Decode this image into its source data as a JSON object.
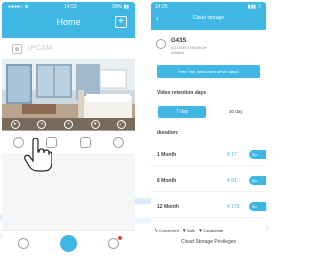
{
  "left_screen": {
    "status_bar": {
      "carrier": "●●●●○ ⊕",
      "time": "14:53",
      "battery": "99% ▮▮"
    },
    "title": "Home",
    "add_icon": "plus-square-icon",
    "device": {
      "name": "IPCAM",
      "icon": "camera-icon"
    },
    "video_controls": [
      "play-icon",
      "speaker-icon",
      "hd-icon",
      "record-icon",
      "fullscreen-icon"
    ],
    "actions": [
      "cloud-icon",
      "sd-card-icon",
      "calendar-icon",
      "settings-icon"
    ],
    "tab_bar": [
      "message-icon",
      "home-icon",
      "user-icon"
    ]
  },
  "right_screen": {
    "status_bar": {
      "time": "14:25",
      "signal": "▮▮▮ ⌔"
    },
    "back": "‹",
    "title": "Cloud storage",
    "device": {
      "name": "G43S",
      "line1": "s/d 12345 67890abcde",
      "line2": "Installed"
    },
    "trial_button": "Free Trial (new users seven days)",
    "retention_heading": "Video retention days",
    "retention_options": {
      "selected": "7 day",
      "other": "30 day"
    },
    "duration_heading": "duration:",
    "plans": [
      {
        "label": "1 Month",
        "price": "¥ 17",
        "button": "Bu"
      },
      {
        "label": "6 Month",
        "price": "¥ 91",
        "button": "Bu"
      },
      {
        "label": "12 Month",
        "price": "¥ 173",
        "button": "Bu"
      }
    ],
    "features": [
      {
        "icon": "lightning-icon",
        "label": "Convenient"
      },
      {
        "icon": "heart-icon",
        "label": "Safe"
      },
      {
        "icon": "heart-icon",
        "label": "Considerati"
      }
    ],
    "privileges": "Cloud Storage Privileges"
  },
  "colors": {
    "accent": "#3fb7e4",
    "background": "#f4f6f8",
    "text_dark": "#3c444c",
    "badge": "#e8463b"
  }
}
